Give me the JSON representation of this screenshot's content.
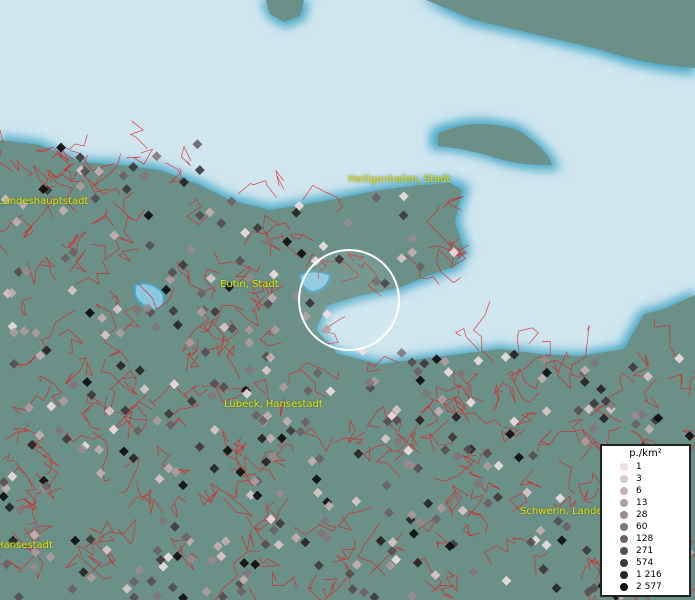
{
  "map": {
    "labels": {
      "heiligenhafen": "Heiligenhafen, Stadt",
      "landeshauptstadt": "Landeshauptstadt",
      "eutin": "Eutin, Stadt",
      "luebeck": "Lübeck, Hansestadt",
      "schwerin": "Schwerin, Landes",
      "hansestadt": "Hansestadt"
    },
    "colors": {
      "sea": "#cfe6ef",
      "land": "#6a9088",
      "coast_glow": "#4aa8c6",
      "boundaries": "#e0221e",
      "selection_circle": "#ffffff"
    }
  },
  "legend": {
    "title": "p./km²",
    "items": [
      {
        "label": "1",
        "color": "#f0dfe1"
      },
      {
        "label": "3",
        "color": "#dcc8ca"
      },
      {
        "label": "6",
        "color": "#c6b0b4"
      },
      {
        "label": "13",
        "color": "#b09ca0"
      },
      {
        "label": "28",
        "color": "#9a8a8e"
      },
      {
        "label": "60",
        "color": "#84767a"
      },
      {
        "label": "128",
        "color": "#6d6165"
      },
      {
        "label": "271",
        "color": "#574d50"
      },
      {
        "label": "574",
        "color": "#3f383a"
      },
      {
        "label": "1 216",
        "color": "#272224"
      },
      {
        "label": "2 577",
        "color": "#0e0c0c"
      }
    ]
  }
}
